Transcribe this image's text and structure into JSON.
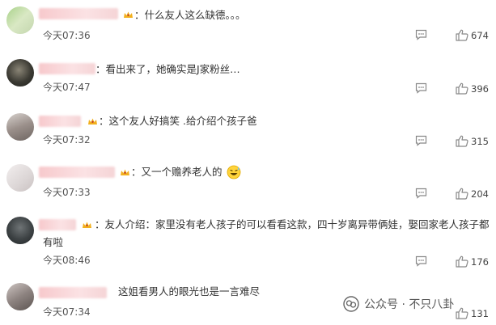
{
  "comments": [
    {
      "text": "：什么友人这么缺德。。。",
      "time": "今天07:36",
      "likes": "674"
    },
    {
      "text": "：看出来了，她确实是J家粉丝…",
      "time": "今天07:47",
      "likes": "396"
    },
    {
      "text": "：这个友人好搞笑 .给介绍个孩子爸",
      "time": "今天07:32",
      "likes": "315"
    },
    {
      "text": "：又一个赡养老人的",
      "time": "今天07:33",
      "likes": "204"
    },
    {
      "text": "：友人介绍：家里没有老人孩子的可以看看这款，四十岁离异带俩娃，娶回家老人孩子都有啦",
      "time": "今天08:46",
      "likes": "176"
    },
    {
      "text": "这姐看男人的眼光也是一言难尽",
      "time": "今天07:34",
      "likes": "131"
    }
  ],
  "emoji": "grinning-sweat-face",
  "watermark": {
    "text": "公众号 · 不只八卦",
    "icon": "wechat-official-account-icon"
  },
  "colors": {
    "username_blur": "#f7c9cc",
    "crown": "#f2b01e",
    "icon": "#888888"
  }
}
